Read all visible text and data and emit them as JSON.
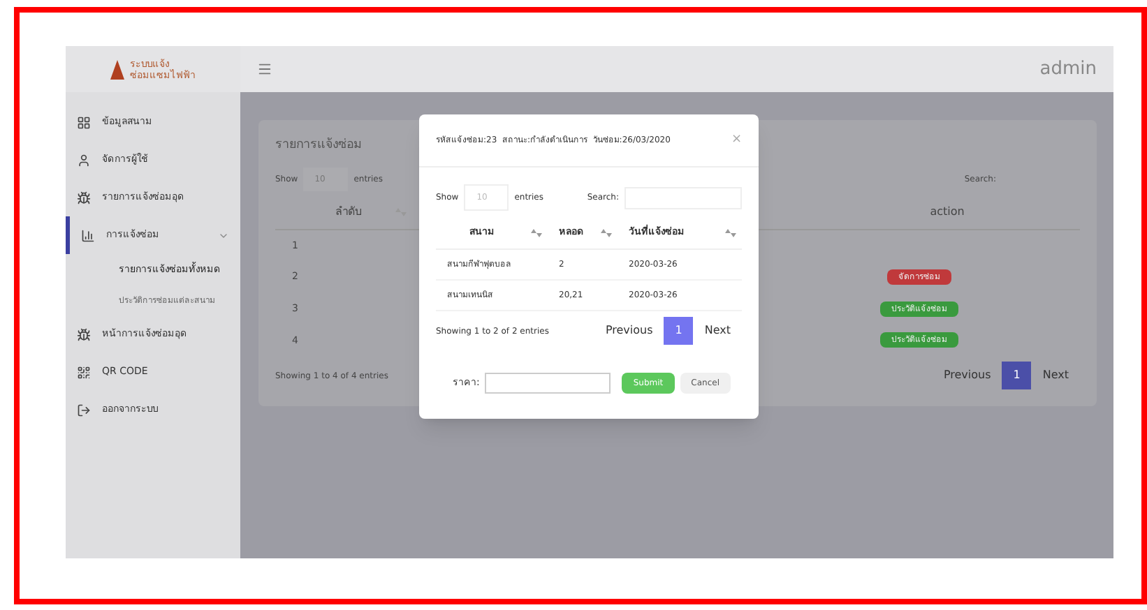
{
  "logo": {
    "line1": "ระบบแจ้ง",
    "line2": "ซ่อมแซมไฟฟ้า"
  },
  "header": {
    "user": "admin"
  },
  "sidebar": {
    "items": [
      {
        "label": "ข้อมูลสนาม",
        "selected": false
      },
      {
        "label": "จัดการผู้ใช้",
        "selected": false
      },
      {
        "label": "รายการแจ้งซ่อมอุด",
        "selected": false
      },
      {
        "label": "การแจ้งซ่อม",
        "selected": true,
        "expanded": true,
        "children": [
          {
            "label": "รายการแจ้งซ่อมทั้งหมด",
            "selected": true
          },
          {
            "label": "ประวัติการซ่อมแต่ละสนาม",
            "selected": false
          }
        ]
      },
      {
        "label": "หน้าการแจ้งซ่อมอุด",
        "selected": false
      },
      {
        "label": "QR CODE",
        "selected": false
      },
      {
        "label": "ออกจากระบบ",
        "selected": false
      }
    ]
  },
  "panel": {
    "title": "รายการแจ้งซ่อม",
    "show": "Show",
    "page_size": "10",
    "entries": "entries",
    "search_label": "Search:",
    "columns": [
      "ลำดับ",
      "action"
    ],
    "rows": [
      {
        "number": "1"
      },
      {
        "number": "2",
        "action": {
          "label": "จัดการซ่อม",
          "color": "#c0393b"
        }
      },
      {
        "number": "3",
        "action": {
          "label": "ประวัติแจ้งซ่อม",
          "color": "#3a9a3e"
        }
      },
      {
        "number": "4",
        "action": {
          "label": "ประวัติแจ้งซ่อม",
          "color": "#3a9a3e"
        }
      }
    ],
    "info": "Showing 1 to 4 of 4 entries",
    "pagination": {
      "previous": "Previous",
      "pages": [
        {
          "label": "1",
          "selected": true
        }
      ],
      "next": "Next"
    }
  },
  "modal": {
    "title": "รหัสแจ้งซ่อม:23  สถานะ:กำลังดำเนินการ  วันซ่อม:26/03/2020",
    "close": "×",
    "show": "Show",
    "page_size": "10",
    "entries": "entries",
    "search_label": "Search:",
    "columns": [
      "สนาม",
      "หลอด",
      "วันที่แจ้งซ่อม"
    ],
    "rows": [
      [
        "สนามกีฬาฟุตบอล",
        "2",
        "2020-03-26"
      ],
      [
        "สนามเทนนิส",
        "20,21",
        "2020-03-26"
      ]
    ],
    "info": "Showing 1 to 2 of 2 entries",
    "pagination": {
      "previous": "Previous",
      "pages": [
        {
          "label": "1",
          "selected": true
        }
      ],
      "next": "Next"
    },
    "price_label": "ราคา:",
    "submit": "Submit",
    "cancel": "Cancel"
  }
}
